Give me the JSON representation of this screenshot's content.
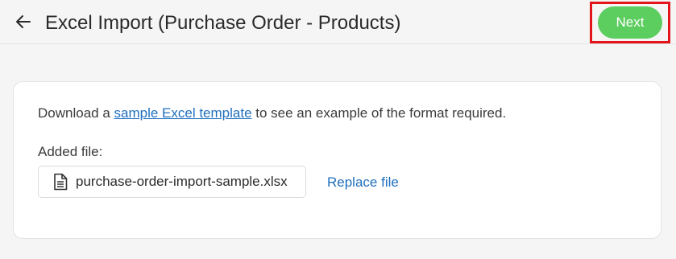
{
  "header": {
    "title": "Excel Import (Purchase Order - Products)",
    "back_icon": "arrow-left-icon",
    "next_label": "Next"
  },
  "card": {
    "intro_prefix": "Download a ",
    "intro_link": "sample Excel template",
    "intro_suffix": " to see an example of the format required.",
    "added_file_label": "Added file:",
    "file_icon": "document-icon",
    "file_name": "purchase-order-import-sample.xlsx",
    "replace_label": "Replace file"
  },
  "colors": {
    "accent_green": "#5ccd5f",
    "link_blue": "#1f6fbf",
    "highlight_red": "#e4141b",
    "background": "#f5f5f6"
  }
}
